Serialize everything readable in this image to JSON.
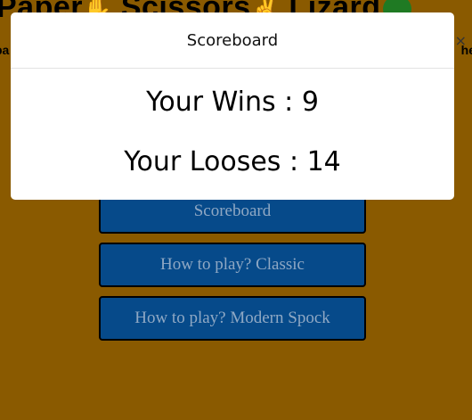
{
  "background": {
    "title_parts": [
      "Paper",
      "Scissors",
      "Lizard"
    ],
    "left_edge_text": "ba",
    "right_edge_text": "he",
    "close_glyph": "×",
    "menu": {
      "scoreboard": "Scoreboard",
      "how_to_play_classic": "How to play? Classic",
      "how_to_play_modern": "How to play? Modern Spock"
    }
  },
  "modal": {
    "title": "Scoreboard",
    "wins_label": "Your Wins : 9",
    "looses_label": "Your Looses : 14"
  },
  "colors": {
    "page_background": "#8a5a00",
    "button_background": "#064a8a",
    "button_text": "#8fa8c4",
    "modal_background": "#ffffff"
  },
  "icons": {
    "paper": "hand-paper-icon",
    "scissors": "hand-scissors-icon",
    "lizard": "lizard-icon"
  }
}
